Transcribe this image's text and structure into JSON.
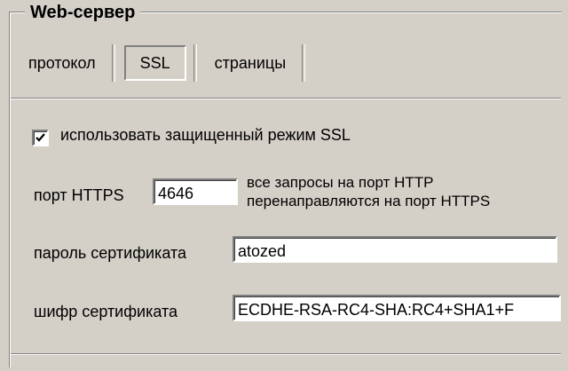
{
  "group": {
    "title": "Web-сервер"
  },
  "tabs": [
    {
      "label": "протокол",
      "active": false
    },
    {
      "label": "SSL",
      "active": true
    },
    {
      "label": "страницы",
      "active": false
    }
  ],
  "ssl": {
    "use_ssl_label": "использовать защищенный режим SSL",
    "use_ssl_checked": true,
    "https_port_label": "порт HTTPS",
    "https_port_value": "4646",
    "redirect_note_line1": "все запросы на порт HTTP",
    "redirect_note_line2": "перенаправляются на порт HTTPS",
    "cert_password_label": "пароль сертификата",
    "cert_password_value": "atozed",
    "cert_cipher_label": "шифр сертификата",
    "cert_cipher_value": "ECDHE-RSA-RC4-SHA:RC4+SHA1+F"
  }
}
